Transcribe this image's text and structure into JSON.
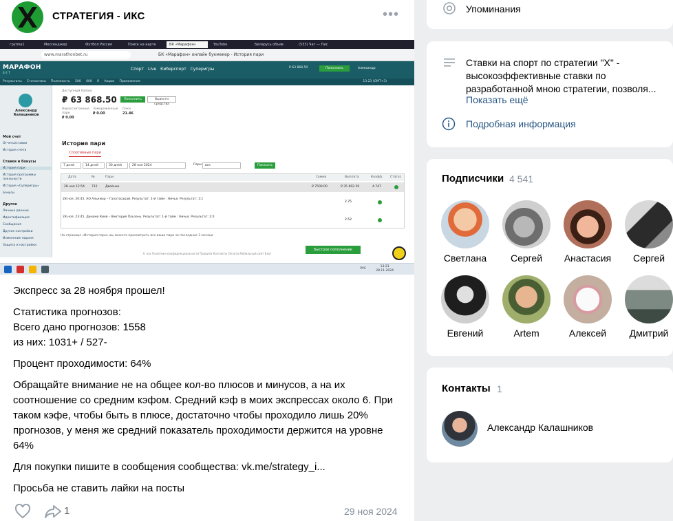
{
  "post": {
    "author": "СТРАТЕГИЯ - ИКС",
    "more": "•••",
    "screenshot": {
      "tabs": [
        "группа1",
        "Мессенджер",
        "Футбол Россия",
        "Поиск на карте",
        "БК «Марафон»",
        "YouTube",
        "Беларусь объяв",
        "(533) Чат — Пис"
      ],
      "url": "www.marathonbet.ru",
      "page_title": "БК «Марафон» онлайн букмекер - История пари",
      "brand": "МАРАФОН",
      "brand_sub": "БЕТ",
      "menu": "Спорт Live Киберспорт Суперигры",
      "balance_top": "₽ 63 868.50",
      "deposit_top": "Пополнить",
      "user_top": "Александр",
      "toolbar": "Результаты Статистика Полезность 500 000 ₽ Акции Приложения",
      "time_top": "13:23 (GMT+3)",
      "side_name": "Александр Калашников",
      "side_head_1": "Мой счет",
      "side_item_1": "Отчеты/ставки",
      "side_item_2": "История счета",
      "side_head_2": "Ставки и бонусы",
      "side_item_3": "История пари",
      "side_item_4": "История программы лояльности",
      "side_item_5": "История «Суперигры»",
      "side_item_6": "Бонусы",
      "side_head_3": "Другое",
      "side_item_7": "Личные данные",
      "side_item_8": "Идентификация",
      "side_item_9": "Сообщения",
      "side_item_10": "Другие настройки",
      "side_item_11": "Изменение пароля",
      "side_item_12": "Защита и настройки",
      "bal_label": "Доступный баланс",
      "bal": "₽ 63 868.50",
      "bal_btn": "Пополнить",
      "bal_btn2": "Вывести средства",
      "stat_1_label": "Нерассчитанные пари",
      "stat_1_value": "₽ 0.00",
      "stat_2_label": "Замороженные",
      "stat_2_value": "₽ 0.00",
      "stat_3_label": "Очки",
      "stat_3_value": "21.46",
      "h1": "История пари",
      "subtab": "Спортивные пари",
      "filter_1": "7 дней",
      "filter_2": "14 дней",
      "filter_3": "30 дней",
      "filter_4": "28 ноя 2024",
      "filter_5": "Пари",
      "filter_6": "все",
      "show": "Показать",
      "col_1": "Дата",
      "col_2": "№",
      "col_3": "Пари",
      "col_4": "Сумма",
      "col_5": "Выплата",
      "col_6": "Коэфф.",
      "col_7": "Статус",
      "row_date": "28 ноя 12:54",
      "row_num": "712",
      "row_type": "Двойник",
      "row_sum": "₽ 7500.00",
      "row_payout": "₽ 35 602.50",
      "row_coef": "4.747",
      "sub_1": "28 ноя, 20:45. АО Алькмар – Галатасарай. Результат: 1-й тайм : Ничья. Результат: 1:1",
      "sub_1_coef": "2.75",
      "sub_2": "28 ноя, 23:45. Динамо Киев – Виктория Пльзень. Результат: 1-й тайм : Ничья. Результат: 2:0",
      "sub_2_coef": "2.52",
      "footnote": "На странице «История пари» вы можете просмотреть все ваши пари за последние 3 месяца",
      "footer": "© нас Политика конфиденциальности Правила Контакты Оплата Мобильный сайт Блог",
      "fast": "Быстрое пополнение",
      "task_lang": "РУС",
      "task_time_1": "13:23",
      "task_time_2": "28.11.2024"
    },
    "text_1": "Экспресс за 28 ноября прошел!",
    "text_2": "Статистика прогнозов:",
    "text_3": "Всего дано прогнозов: 1558",
    "text_4": "из них: 1031+ / 527-",
    "text_5": "Процент проходимости: 64%",
    "text_6": "Обращайте внимание не на общее кол-во плюсов и минусов, а на их соотношение со средним кэфом. Средний кэф в моих экспрессах около 6. При таком кэфе, чтобы быть в плюсе, достаточно чтобы проходило лишь 20% прогнозов, у меня же средний показатель проходимости держится на уровне 64%",
    "text_7": "Для покупки пишите в сообщения сообщества: vk.me/strategy_i...",
    "text_8": "Просьба не ставить лайки на посты",
    "share_count": "1",
    "date": "29 ноя 2024"
  },
  "sidebar": {
    "mentions": "Упоминания",
    "about": "Ставки на спорт по стратегии \"X\" - высокоэффективные ставки по разработанной мною стратегии, позволя...",
    "about_more": "Показать ещё",
    "info": "Подробная информация",
    "subscribers_title": "Подписчики",
    "subscribers_count": "4 541",
    "subscribers": [
      {
        "name": "Светлана"
      },
      {
        "name": "Сергей"
      },
      {
        "name": "Анастасия"
      },
      {
        "name": "Сергей"
      },
      {
        "name": "Евгений"
      },
      {
        "name": "Artem"
      },
      {
        "name": "Алексей"
      },
      {
        "name": "Дмитрий"
      }
    ],
    "contacts_title": "Контакты",
    "contacts_count": "1",
    "contact_name": "Александр Калашников"
  },
  "colors": {
    "link": "#2a5885",
    "muted": "#818c99",
    "brand_green": "#1e9b33",
    "bookmaker_teal": "#1b5d67"
  }
}
